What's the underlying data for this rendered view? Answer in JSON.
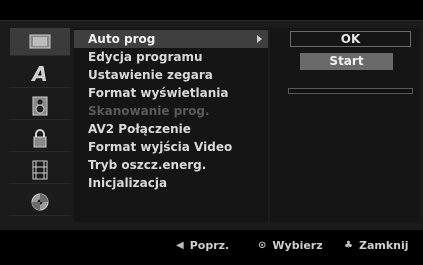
{
  "menu": {
    "items": [
      {
        "label": "Auto prog",
        "selected": true,
        "disabled": false
      },
      {
        "label": "Edycja programu",
        "selected": false,
        "disabled": false
      },
      {
        "label": "Ustawienie zegara",
        "selected": false,
        "disabled": false
      },
      {
        "label": "Format wyświetlania",
        "selected": false,
        "disabled": false
      },
      {
        "label": "Skanowanie prog.",
        "selected": false,
        "disabled": true
      },
      {
        "label": "AV2 Połączenie",
        "selected": false,
        "disabled": false
      },
      {
        "label": "Format wyjścia Video",
        "selected": false,
        "disabled": false
      },
      {
        "label": "Tryb oszcz.energ.",
        "selected": false,
        "disabled": false
      },
      {
        "label": "Inicjalizacja",
        "selected": false,
        "disabled": false
      }
    ]
  },
  "sidebar": {
    "categories": [
      {
        "name": "general",
        "icon": "tv-icon",
        "active": true
      },
      {
        "name": "language",
        "icon": "letter-a-icon",
        "active": false
      },
      {
        "name": "audio",
        "icon": "speaker-icon",
        "active": false
      },
      {
        "name": "lock",
        "icon": "lock-icon",
        "active": false
      },
      {
        "name": "recording",
        "icon": "film-icon",
        "active": false
      },
      {
        "name": "disc",
        "icon": "disc-icon",
        "active": false
      }
    ]
  },
  "right": {
    "ok_label": "OK",
    "start_label": "Start",
    "progress": 0
  },
  "footer": {
    "prev_label": "Poprz.",
    "select_label": "Wybierz",
    "close_label": "Zamknij",
    "prev_icon": "left-triangle-icon",
    "select_icon": "circle-dot-icon",
    "close_icon": "setup-icon"
  }
}
